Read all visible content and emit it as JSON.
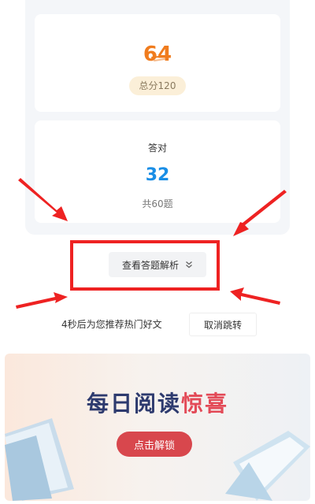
{
  "score": {
    "value": "64",
    "total_label": "总分120"
  },
  "correct": {
    "label": "答对",
    "value": "32",
    "total_label": "共60题"
  },
  "analysis_button": {
    "label": "查看答题解析",
    "icon": "double-chevron-down-icon"
  },
  "redirect": {
    "countdown_text": "4秒后为您推荐热门好文",
    "cancel_label": "取消跳转"
  },
  "banner": {
    "title_main": "每日阅读",
    "title_accent": "惊喜",
    "unlock_label": "点击解锁"
  },
  "colors": {
    "score_orange": "#f07c1e",
    "correct_blue": "#1a8ee6",
    "annotation_red": "#ee2222",
    "banner_navy": "#2d3a6e",
    "unlock_red": "#d8474d"
  }
}
